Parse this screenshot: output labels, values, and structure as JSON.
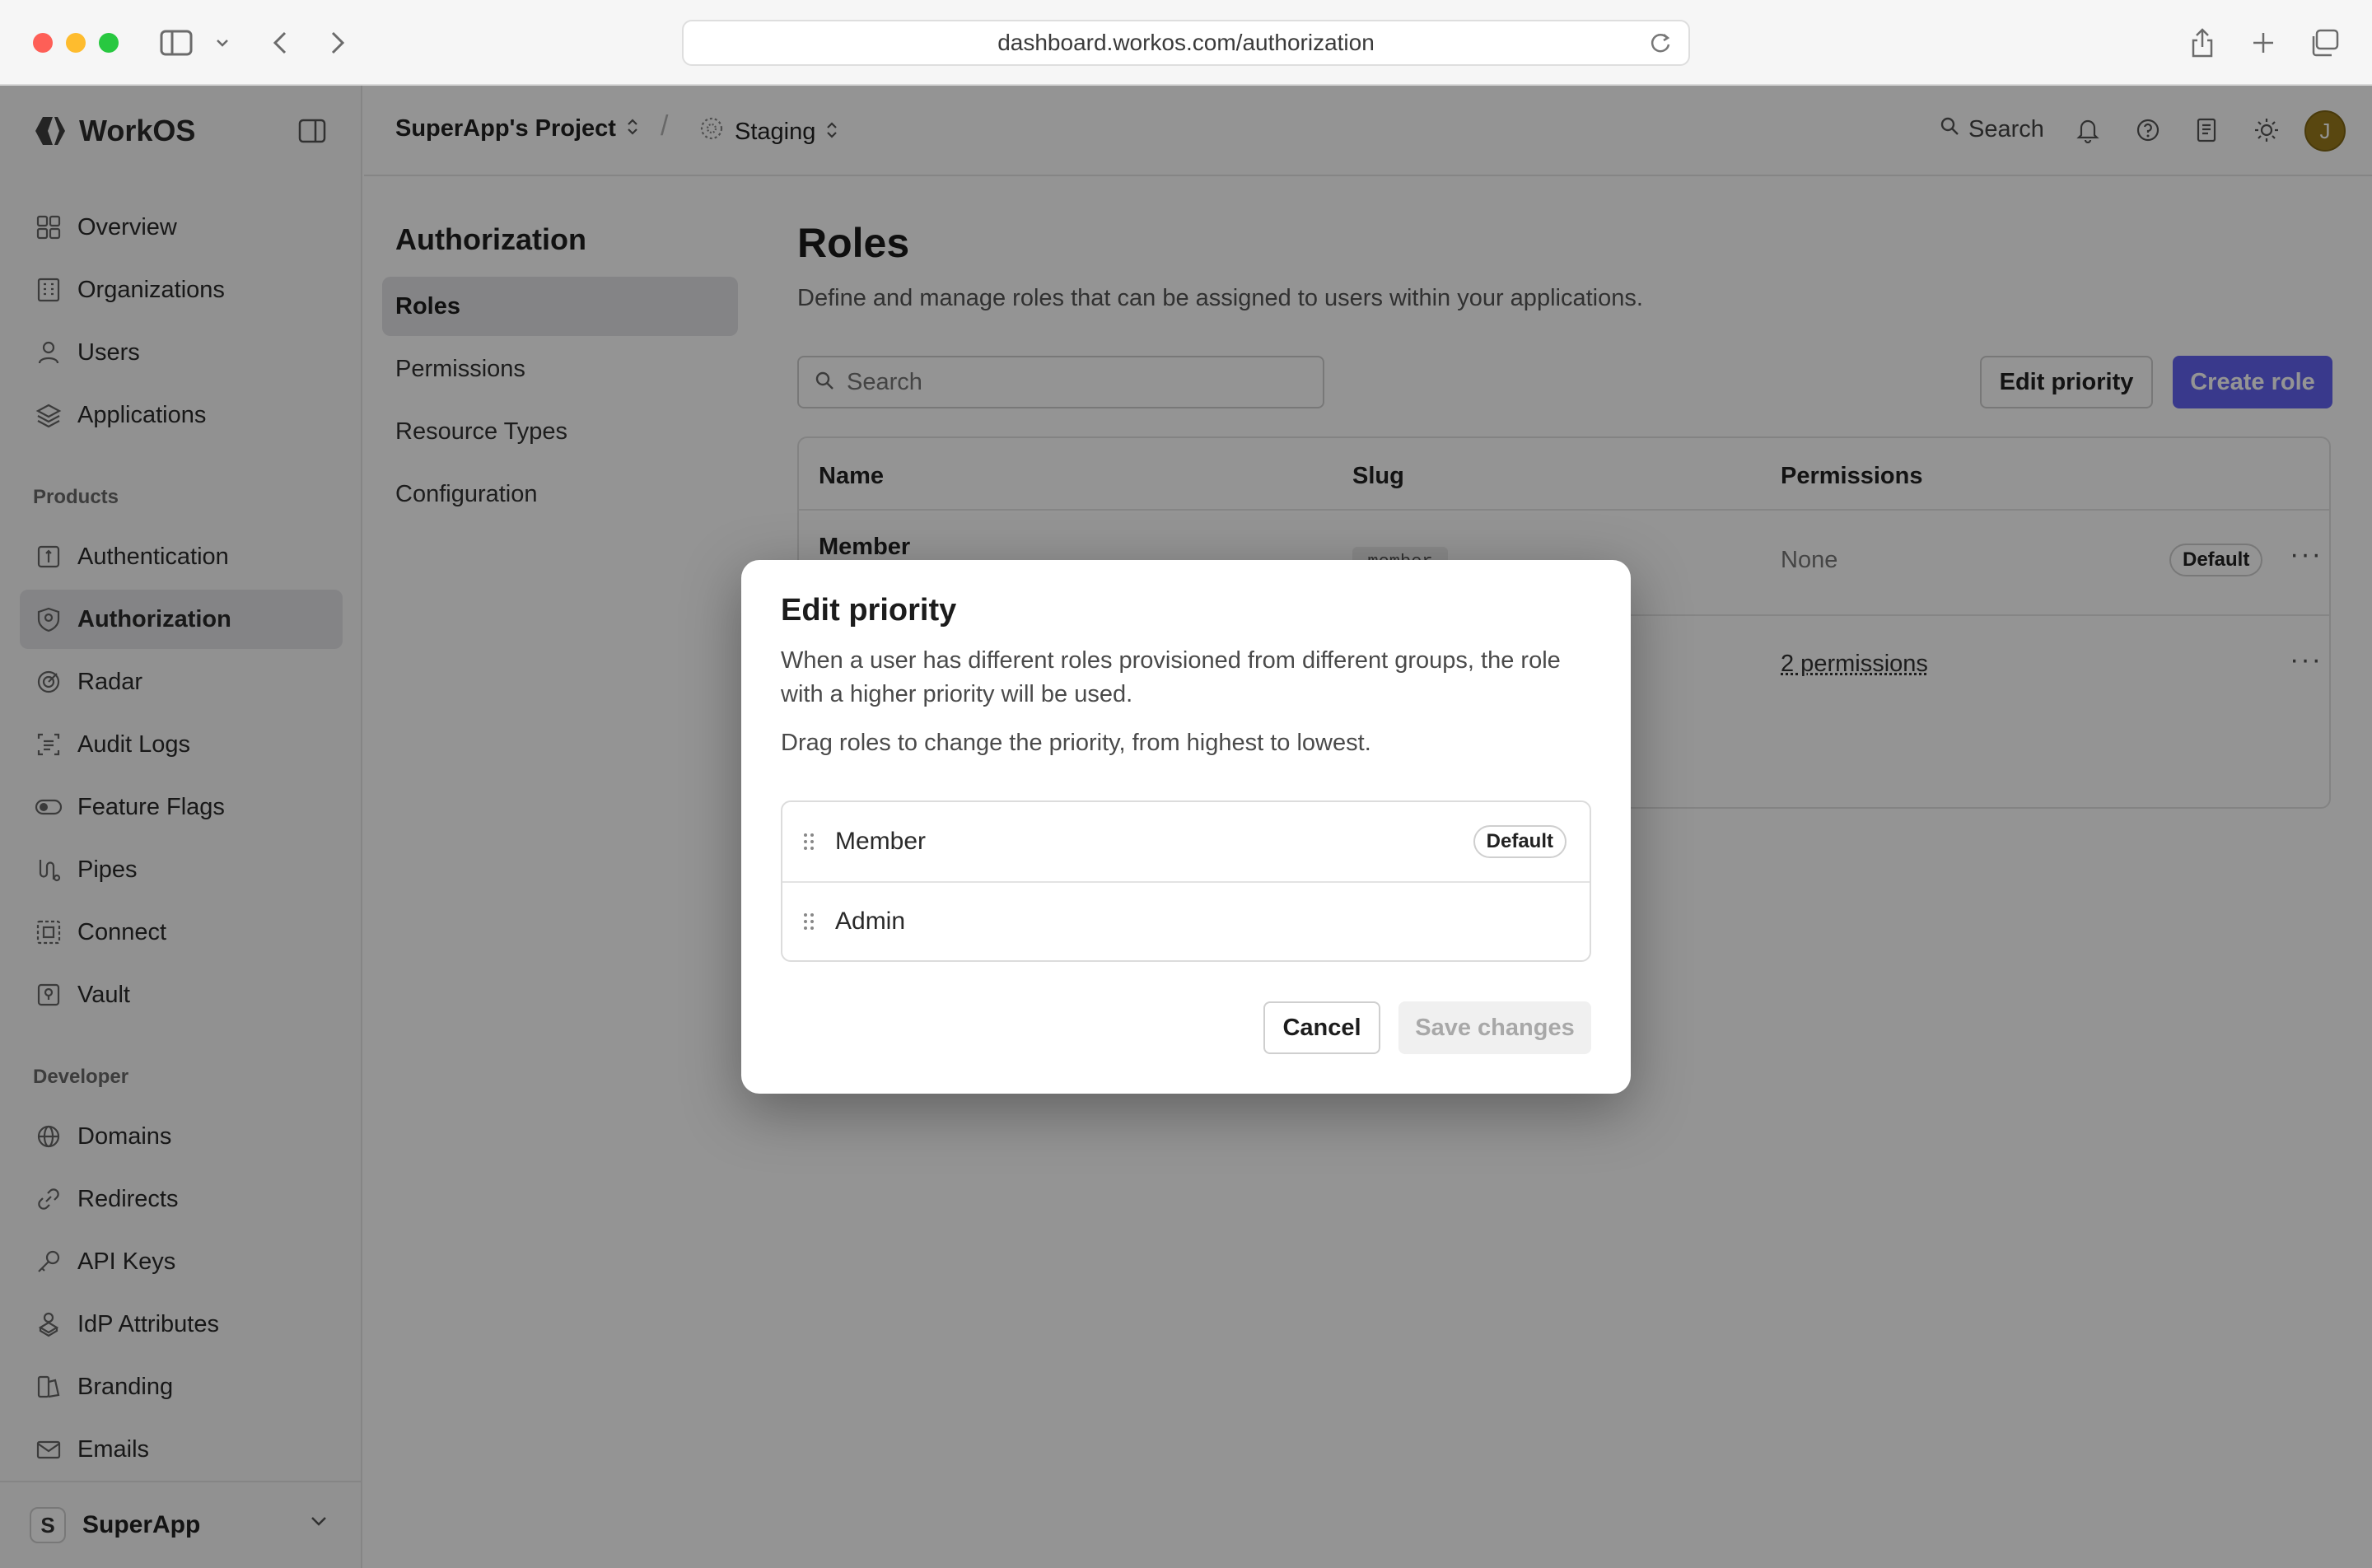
{
  "browser": {
    "url": "dashboard.workos.com/authorization"
  },
  "sidebar": {
    "brand": "WorkOS",
    "items": [
      {
        "label": "Overview",
        "icon": "grid-icon"
      },
      {
        "label": "Organizations",
        "icon": "building-icon"
      },
      {
        "label": "Users",
        "icon": "user-icon"
      },
      {
        "label": "Applications",
        "icon": "layers-icon"
      }
    ],
    "products_label": "Products",
    "products": [
      {
        "label": "Authentication",
        "icon": "auth-icon"
      },
      {
        "label": "Authorization",
        "icon": "shield-icon",
        "active": true
      },
      {
        "label": "Radar",
        "icon": "radar-icon"
      },
      {
        "label": "Audit Logs",
        "icon": "audit-icon"
      },
      {
        "label": "Feature Flags",
        "icon": "toggle-icon"
      },
      {
        "label": "Pipes",
        "icon": "pipes-icon"
      },
      {
        "label": "Connect",
        "icon": "connect-icon"
      },
      {
        "label": "Vault",
        "icon": "vault-icon"
      }
    ],
    "developer_label": "Developer",
    "developer": [
      {
        "label": "Domains",
        "icon": "globe-icon"
      },
      {
        "label": "Redirects",
        "icon": "link-icon"
      },
      {
        "label": "API Keys",
        "icon": "key-icon"
      },
      {
        "label": "IdP Attributes",
        "icon": "attributes-icon"
      },
      {
        "label": "Branding",
        "icon": "branding-icon"
      },
      {
        "label": "Emails",
        "icon": "mail-icon"
      }
    ],
    "workspace": {
      "initial": "S",
      "name": "SuperApp"
    }
  },
  "topbar": {
    "project": "SuperApp's Project",
    "environment": "Staging",
    "search": "Search",
    "avatar_initial": "J"
  },
  "subnav": {
    "title": "Authorization",
    "items": [
      "Roles",
      "Permissions",
      "Resource Types",
      "Configuration"
    ]
  },
  "main": {
    "title": "Roles",
    "description": "Define and manage roles that can be assigned to users within your applications.",
    "search_placeholder": "Search",
    "edit_priority_label": "Edit priority",
    "create_role_label": "Create role",
    "columns": [
      "Name",
      "Slug",
      "Permissions"
    ],
    "rows": [
      {
        "name": "Member",
        "slug": "member",
        "permissions": "None",
        "badge": "Default"
      },
      {
        "name": "",
        "slug": "",
        "permissions": "2 permissions",
        "badge": ""
      }
    ]
  },
  "modal": {
    "title": "Edit priority",
    "description": "When a user has different roles provisioned from different groups, the role with a higher priority will be used.",
    "hint": "Drag roles to change the priority, from highest to lowest.",
    "roles": [
      {
        "name": "Member",
        "badge": "Default"
      },
      {
        "name": "Admin",
        "badge": ""
      }
    ],
    "cancel_label": "Cancel",
    "save_label": "Save changes"
  },
  "colors": {
    "accent": "#6363f1",
    "avatar": "#9a7b1c"
  }
}
